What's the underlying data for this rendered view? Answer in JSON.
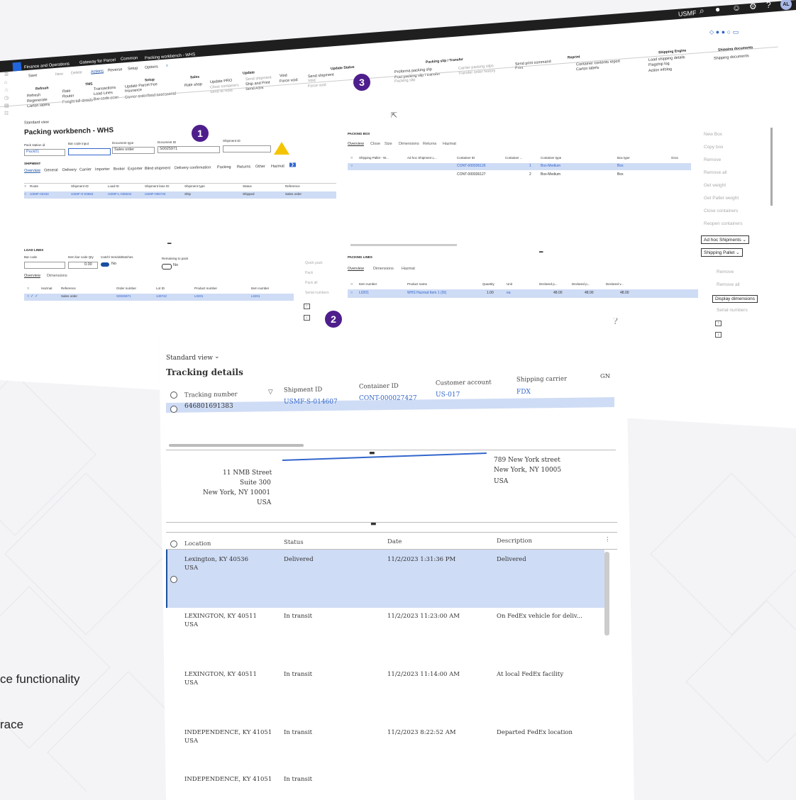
{
  "app": {
    "product": "Finance and Operations",
    "breadcrumb": [
      "Gateway for Parcel",
      "Common",
      "Packing workbench - WHS"
    ],
    "company": "USMF",
    "user_initials": "AL"
  },
  "ribbon": {
    "menu": [
      "Save",
      "New",
      "Delete",
      "Actions",
      "Reverse",
      "Setup",
      "Options"
    ],
    "groups": {
      "refresh": {
        "title": "Refresh",
        "items": [
          "Refresh",
          "Regenerate",
          "Carton labels"
        ]
      },
      "tms": {
        "title": "TMS",
        "items": [
          "Rate",
          "Router",
          "Freight bill details",
          "Transactions",
          "Load Lines",
          "Bar code scan"
        ]
      },
      "setup": {
        "title": "Setup",
        "items": [
          "Update Parcel Fee",
          "Insurance",
          "Carrier order/load accessorial"
        ]
      },
      "sales": {
        "title": "Sales",
        "items": [
          "Rate shop"
        ]
      },
      "update": {
        "title": "Update",
        "items": [
          "Update PRO",
          "Close containers",
          "Send to Hold",
          "Send shipment",
          "Ship and Print",
          "Send ASN",
          "Void",
          "Force void"
        ]
      },
      "update_status": {
        "title": "Update Status",
        "items": [
          "Send shipment",
          "Void",
          "Force void"
        ]
      },
      "packing_slip": {
        "title": "Packing slip / Transfer",
        "items": [
          "Proforma packing slip",
          "Post packing slip / transfer",
          "Packing slip",
          "Carrier packing slips",
          "Transfer order history"
        ]
      },
      "print": {
        "items": [
          "Send print command",
          "Print"
        ]
      },
      "reprint": {
        "title": "Reprint",
        "items": [
          "Container contents report",
          "Carton labels"
        ]
      },
      "shipping_engine": {
        "title": "Shipping Engine",
        "items": [
          "Load shipping details",
          "Flagship log",
          "Action infolog"
        ]
      },
      "shipping_documents": {
        "title": "Shipping documents",
        "items": [
          "Shipping documents"
        ]
      }
    }
  },
  "workbench": {
    "view": "Standard view",
    "title": "Packing workbench - WHS",
    "fields": {
      "pack_station_label": "Pack station id",
      "pack_station_value": "Pack01",
      "barcode_label": "Bar code input",
      "doc_type_label": "Document type",
      "doc_type_value": "Sales order",
      "doc_id_label": "Document ID",
      "doc_id_value": "S0025971",
      "shipment_id_label": "Shipment ID"
    },
    "shipment": {
      "title": "SHIPMENT",
      "tabs": [
        "Overview",
        "General",
        "Delivery",
        "Carrier",
        "Importer",
        "Broker",
        "Exporter",
        "Blind shipment",
        "Delivery confirmation",
        "Packing",
        "Returns",
        "Other",
        "Hazmat"
      ],
      "columns": [
        "Route",
        "Shipment ID",
        "Load ID",
        "Shipment lane ID",
        "Shipment type",
        "Status",
        "Reference"
      ],
      "rows": [
        [
          "USMF-02232",
          "USMF-S-03583",
          "USMF-L-035534",
          "USMF-006733",
          "Ship",
          "Shipped",
          "Sales order"
        ]
      ]
    },
    "load_lines": {
      "title": "LOAD LINES",
      "bar_code_label": "Bar code",
      "item_qty_label": "Item bar code Qty",
      "item_qty_value": "0.00",
      "catch_label": "Catch/ Serials/Batches",
      "catch_value": "No",
      "remaining_label": "Remaining to pack",
      "remaining_value": "No",
      "tabs": [
        "Overview",
        "Dimensions"
      ],
      "columns": [
        "Hazmat",
        "Reference",
        "Order number",
        "Lot ID",
        "Product number",
        "Item number"
      ],
      "rows": [
        [
          "",
          "Sales order",
          "S0025971",
          "149742",
          "L0201",
          "L0201"
        ]
      ],
      "actions": [
        "Quick pack",
        "Pack",
        "Pack all",
        "Serial numbers"
      ]
    },
    "packing_box": {
      "title": "PACKING BOX",
      "tabs": [
        "Overview",
        "Close",
        "Size",
        "Dimensions",
        "Returns",
        "Hazmat"
      ],
      "columns": [
        "Shipping Pallet - W...",
        "Ad hoc Shipment L...",
        "Container ID",
        "Container ...",
        "Container type",
        "Box type",
        "Gros"
      ],
      "rows": [
        [
          "",
          "",
          "CONT-000036126",
          "1",
          "Box-Medium",
          "Box"
        ],
        [
          "",
          "",
          "CONT-000036127",
          "2",
          "Box-Medium",
          "Box"
        ]
      ]
    },
    "packing_lines": {
      "title": "PACKING LINES",
      "tabs": [
        "Overview",
        "Dimensions",
        "Hazmat"
      ],
      "columns": [
        "Item number",
        "Product name",
        "Quantity",
        "Unit",
        "Declared p...",
        "Declared p...",
        "Declared v..."
      ],
      "rows": [
        [
          "L0201",
          "WHS Hazmat Item 1 (Dt)",
          "1.00",
          "ea",
          "48.00",
          "48.00",
          "48.00"
        ]
      ]
    },
    "side_buttons": [
      "New Box",
      "Copy box",
      "Remove",
      "Remove all",
      "Get weight",
      "Get Pallet weight",
      "Close containers",
      "Reopen containers",
      "Ad hoc Shipments",
      "Shipping Pallet"
    ],
    "side_buttons2": [
      "Remove",
      "Remove all",
      "Display dimensions",
      "Serial numbers"
    ]
  },
  "badges": [
    "1",
    "2",
    "3"
  ],
  "tracking": {
    "help": "?",
    "view": "Standard view",
    "title": "Tracking details",
    "columns": [
      "Tracking number",
      "Shipment ID",
      "Container ID",
      "Customer account",
      "Shipping carrier",
      "GN"
    ],
    "rows": [
      [
        "646801691383",
        "USMF-S-014607",
        "CONT-000027427",
        "US-017",
        "FDX",
        ""
      ]
    ],
    "from_address": [
      "11 NMB Street",
      "Suite 300",
      "New York, NY 10001",
      "USA"
    ],
    "to_address": [
      "789 New York street",
      "New York, NY 10005",
      "USA"
    ],
    "history_columns": [
      "Location",
      "Status",
      "Date",
      "Description"
    ],
    "history": [
      {
        "location": "Lexington, KY 40536",
        "country": "USA",
        "status": "Delivered",
        "date": "11/2/2023 1:31:36 PM",
        "description": "Delivered"
      },
      {
        "location": "LEXINGTON, KY 40511",
        "country": "USA",
        "status": "In transit",
        "date": "11/2/2023 11:23:00 AM",
        "description": "On FedEx vehicle for deliv..."
      },
      {
        "location": "LEXINGTON, KY 40511",
        "country": "USA",
        "status": "In transit",
        "date": "11/2/2023 11:14:00 AM",
        "description": "At local FedEx facility"
      },
      {
        "location": "INDEPENDENCE, KY 41051",
        "country": "USA",
        "status": "In transit",
        "date": "11/2/2023 8:22:52 AM",
        "description": "Departed FedEx location"
      },
      {
        "location": "INDEPENDENCE, KY 41051",
        "country": "",
        "status": "In transit",
        "date": "",
        "description": ""
      }
    ]
  },
  "left_text": [
    "ce functionality",
    "race"
  ]
}
